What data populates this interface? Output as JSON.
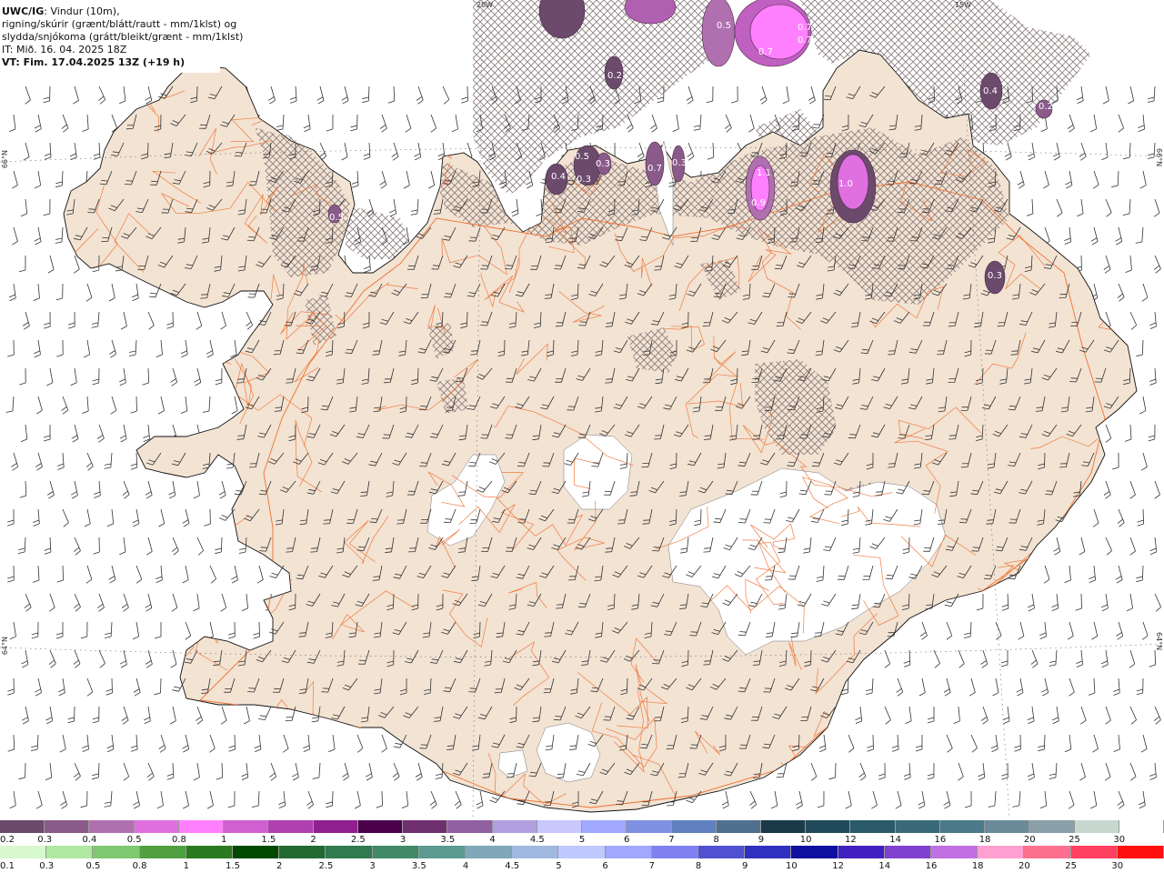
{
  "header": {
    "model": "UWC/IG",
    "line1_rest": ": Vindur (10m),",
    "line2": "rigning/skúrir (grænt/blátt/rautt - mm/1klst) og",
    "line3": "slydda/snjókoma (grátt/bleikt/grænt - mm/1klst)",
    "line4": "IT: Mið. 16. 04. 2025 18Z",
    "line5": "VT: Fim. 17.04.2025 13Z (+19 h)"
  },
  "grid_labels": {
    "lat66_left": "66°N",
    "lat66_right": "66°N",
    "lat64_left": "64°N",
    "lat64_right": "64°N",
    "lon20": "20W",
    "lon15": "15W"
  },
  "snow_labels": [
    {
      "value": "0.5"
    },
    {
      "value": "0.7"
    },
    {
      "value": "0.7"
    },
    {
      "value": "0.7"
    },
    {
      "value": "0.2"
    },
    {
      "value": "0.4"
    },
    {
      "value": "0.2"
    },
    {
      "value": "0.5"
    },
    {
      "value": "0.4"
    },
    {
      "value": "0.3"
    },
    {
      "value": "0.3"
    },
    {
      "value": "0.7"
    },
    {
      "value": "0.3"
    },
    {
      "value": "1.1"
    },
    {
      "value": "0.9"
    },
    {
      "value": "1.0"
    },
    {
      "value": "0.5"
    },
    {
      "value": "0.3"
    }
  ],
  "legend_snow": {
    "labels": [
      "0.2",
      "0.3",
      "0.4",
      "0.5",
      "0.8",
      "1",
      "1.5",
      "2",
      "2.5",
      "3",
      "3.5",
      "4",
      "4.5",
      "5",
      "6",
      "7",
      "8",
      "9",
      "10",
      "12",
      "14",
      "16",
      "18",
      "20",
      "25",
      "30"
    ],
    "colors": [
      "#6b4a6b",
      "#8a5a8a",
      "#b070b0",
      "#e070e0",
      "#ff80ff",
      "#d060d0",
      "#b040b0",
      "#902090",
      "#4a004a",
      "#703070",
      "#9060a0",
      "#b0a0e0",
      "#c8c8ff",
      "#a0a8ff",
      "#8090e0",
      "#6080c0",
      "#507090",
      "#1a3a4a",
      "#204a5a",
      "#2a5a6a",
      "#3a6a7a",
      "#4a7a8a",
      "#6a8a9a",
      "#8aa0a8",
      "#c8d8d0",
      "#ffffff"
    ]
  },
  "legend_rain": {
    "labels": [
      "0.1",
      "0.3",
      "0.5",
      "0.8",
      "1",
      "1.5",
      "2",
      "2.5",
      "3",
      "3.5",
      "4",
      "4.5",
      "5",
      "6",
      "7",
      "8",
      "9",
      "10",
      "12",
      "14",
      "16",
      "18",
      "20",
      "25",
      "30"
    ],
    "colors": [
      "#d8f8d0",
      "#b0e8a0",
      "#80c870",
      "#50a040",
      "#2a7a20",
      "#004a00",
      "#206a30",
      "#307a50",
      "#408a68",
      "#5a9a90",
      "#80a8b8",
      "#a0b8e0",
      "#c0c8ff",
      "#a0a8ff",
      "#8080f0",
      "#5050d0",
      "#3030c0",
      "#1010a0",
      "#4020c0",
      "#8040d0",
      "#c070e0",
      "#ffa0d0",
      "#ff7090",
      "#ff4060",
      "#ff1010"
    ]
  },
  "colors": {
    "land": "#f2e3d3",
    "road": "#f07030",
    "coast": "#111111",
    "glacier": "#ffffff"
  }
}
